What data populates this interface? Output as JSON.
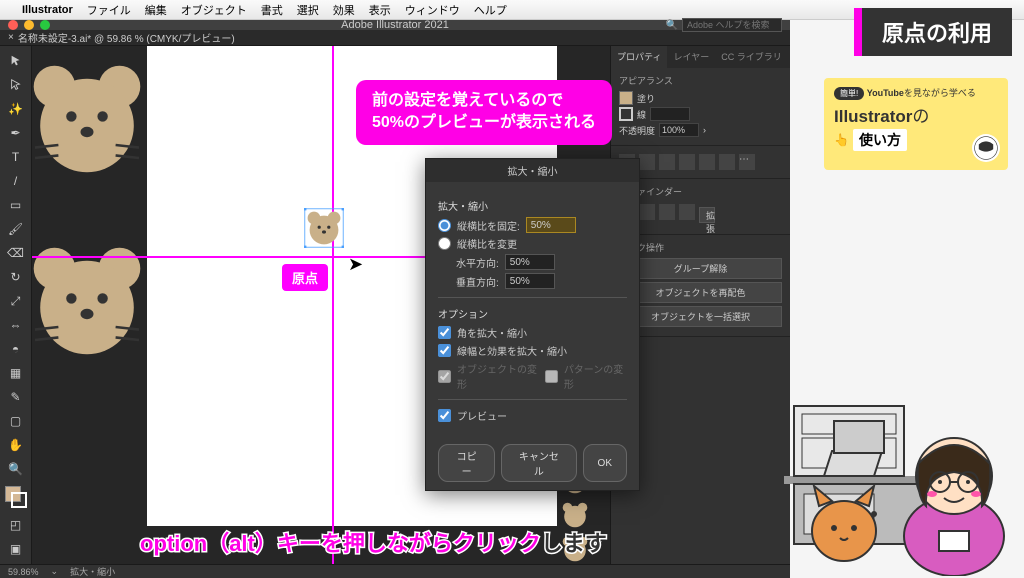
{
  "menubar": {
    "apple": "",
    "app": "Illustrator",
    "items": [
      "ファイル",
      "編集",
      "オブジェクト",
      "書式",
      "選択",
      "効果",
      "表示",
      "ウィンドウ",
      "ヘルプ"
    ]
  },
  "titlebar": {
    "title": "Adobe Illustrator 2021",
    "search_placeholder": "Adobe ヘルプを検索"
  },
  "tab": {
    "close": "×",
    "name": "名称未設定-3.ai* @ 59.86 % (CMYK/プレビュー)"
  },
  "origin_label": "原点",
  "panels": {
    "tabs": [
      "プロパティ",
      "レイヤー",
      "CC ライブラリ"
    ],
    "appearance": {
      "title": "アピアランス",
      "fill": "塗り",
      "stroke": "線",
      "opacity_label": "不透明度",
      "opacity": "100%"
    },
    "pathfinder": {
      "title": "スファインダー",
      "expand": "拡張"
    },
    "quick": {
      "title": "イック操作",
      "ungroup": "グループ解除",
      "recolor": "オブジェクトを再配色",
      "select_all": "オブジェクトを一括選択"
    }
  },
  "dialog": {
    "title": "拡大・縮小",
    "section_scale": "拡大・縮小",
    "radio_uniform": "縦横比を固定:",
    "uniform_value": "50%",
    "radio_nonuniform": "縦横比を変更",
    "horizontal_label": "水平方向:",
    "horizontal_value": "50%",
    "vertical_label": "垂直方向:",
    "vertical_value": "50%",
    "section_options": "オプション",
    "opt_corners": "角を拡大・縮小",
    "opt_strokes": "線幅と効果を拡大・縮小",
    "opt_transform_obj": "オブジェクトの変形",
    "opt_transform_pat": "パターンの変形",
    "preview": "プレビュー",
    "btn_copy": "コピー",
    "btn_cancel": "キャンセル",
    "btn_ok": "OK"
  },
  "callout": {
    "line1": "前の設定を覚えているので",
    "line2": "50%のプレビューが表示される"
  },
  "statusbar": {
    "zoom": "59.86%",
    "tool": "拡大・縮小"
  },
  "topic": "原点の利用",
  "tut_card": {
    "badge": "簡単!",
    "yt_bold": "YouTube",
    "yt_rest": "を見ながら学べる",
    "name_bold": "Illustrator",
    "name_rest": "の",
    "pointer": "👆",
    "usage": "使い方"
  },
  "caption": {
    "pink": "option（alt）キーを押しながらクリック",
    "black": "します"
  }
}
